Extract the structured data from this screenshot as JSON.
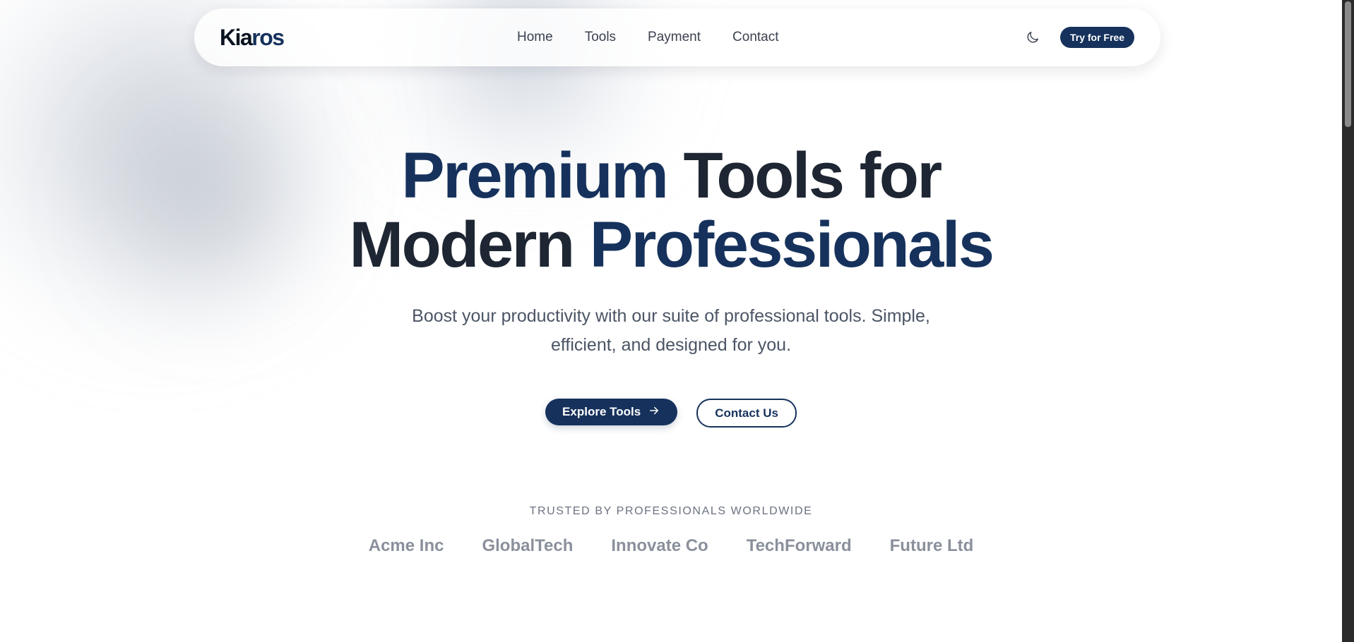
{
  "nav": {
    "logo_primary": "Kia",
    "logo_accent": "ros",
    "links": [
      "Home",
      "Tools",
      "Payment",
      "Contact"
    ],
    "theme_icon": "moon-icon",
    "cta_label": "Try for Free"
  },
  "hero": {
    "title_line1_accent": "Premium",
    "title_line1_rest": "Tools for",
    "title_line2_plain": "Modern",
    "title_line2_accent": "Professionals",
    "subtitle_line1": "Boost your productivity with our suite of professional tools. Simple,",
    "subtitle_line2": "efficient, and designed for you.",
    "primary_cta": "Explore Tools",
    "primary_cta_icon": "arrow-right-icon",
    "secondary_cta": "Contact Us"
  },
  "trusted": {
    "label": "TRUSTED BY PROFESSIONALS WORLDWIDE",
    "companies": [
      "Acme Inc",
      "GlobalTech",
      "Innovate Co",
      "TechForward",
      "Future Ltd"
    ]
  },
  "colors": {
    "brand": "#16325c",
    "text": "#1e2633",
    "muted": "#8a909b"
  }
}
